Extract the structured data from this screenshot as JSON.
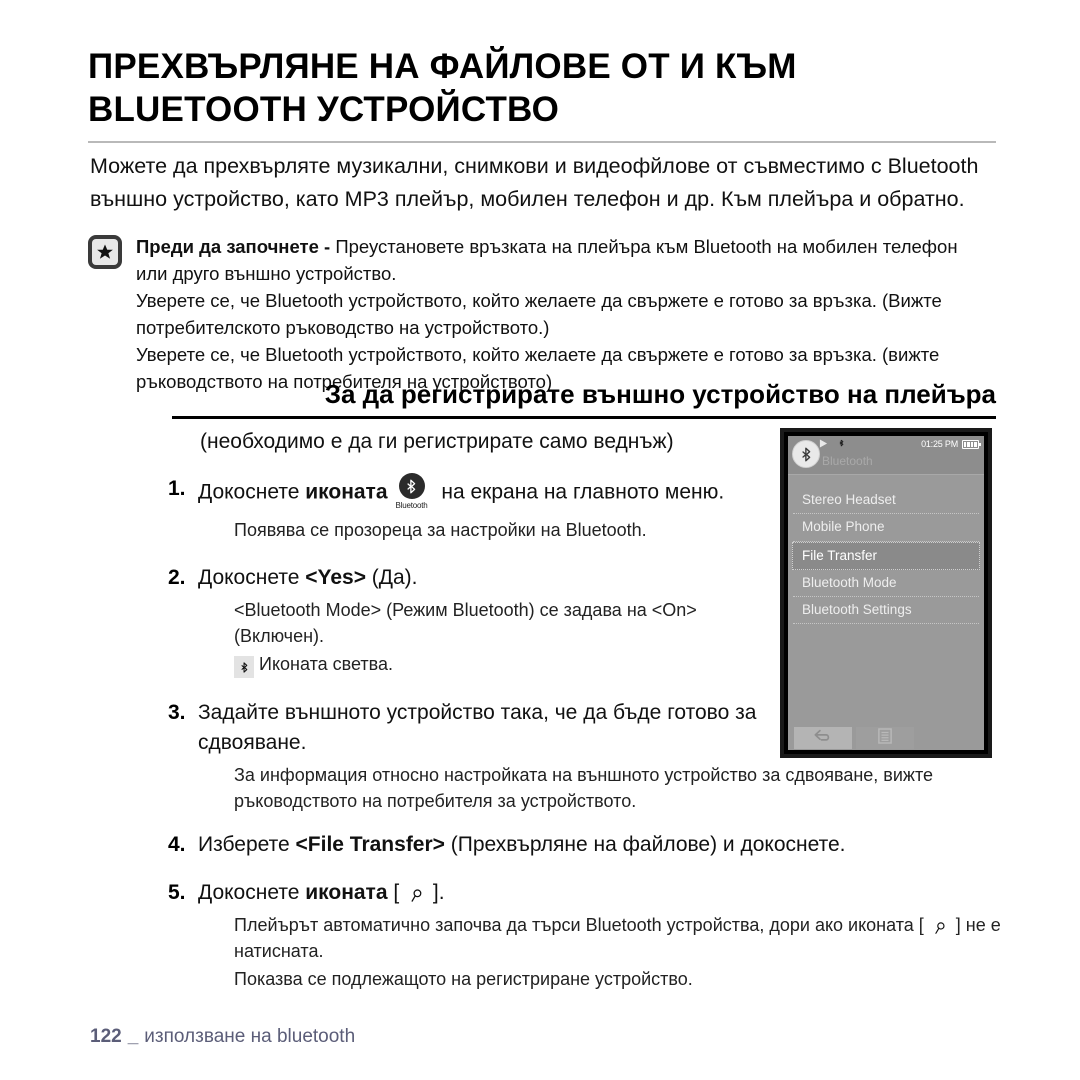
{
  "page": {
    "title": "ПРЕХВЪРЛЯНЕ НА ФАЙЛОВЕ ОТ И КЪМ BLUETOOTH УСТРОЙСТВО",
    "intro": "Можете да прехвърляте музикални, снимкови и видеофйлове от съвместимо с Bluetooth външно устройство, като MP3 плейър, мобилен телефон и др. Към плейъра и обратно."
  },
  "note": {
    "icon": "star-icon",
    "lead": "Преди да започнете - ",
    "line1": "Преустановете връзката на плейъра към Bluetooth на мобилен телефон или друго външно устройство.",
    "line2": "Уверете се, че Bluetooth устройството, който желаете да свържете е готово за връзка. (Вижте потребителското ръководство на устройството.)",
    "line3": "Уверете се, че Bluetooth устройството, който желаете да свържете е готово за връзка. (вижте ръководството на потребителя на устройството)"
  },
  "section": {
    "heading": "За да регистрирате външно устройство на плейъра",
    "once_note": "(необходимо е да ги регистрирате само веднъж)"
  },
  "steps": {
    "s1": {
      "num": "1.",
      "pre": "Докоснете ",
      "bold": "иконата",
      "icon": "bluetooth-icon",
      "icon_label": "Bluetooth",
      "post": " на екрана на главното меню.",
      "sub": "Появява се прозореца за настройки на Bluetooth."
    },
    "s2": {
      "num": "2.",
      "pre": "Докоснете ",
      "bold": "<Yes>",
      "post": " (Да).",
      "sub1": "<Bluetooth Mode> (Режим Bluetooth) се задава на <On> (Включен).",
      "sub2_icon": "bluetooth-chip-icon",
      "sub2": "Иконата светва."
    },
    "s3": {
      "num": "3.",
      "text": "Задайте външното устройство така, че да бъде готово за сдвояване.",
      "sub": "За информация относно настройката на външното устройство за сдвояване, вижте ръководството на потребителя за устройството."
    },
    "s4": {
      "num": "4.",
      "pre": "Изберете  ",
      "bold": "<File Transfer>",
      "post": " (Прехвърляне на файлове) и докоснете."
    },
    "s5": {
      "num": "5.",
      "pre": "Докоснете ",
      "bold": "иконата",
      "bracket_open": " [ ",
      "icon": "search-icon",
      "bracket_close": " ].",
      "sub1a": "Плейърът автоматично започва да търси Bluetooth устройства, дори ако иконата [ ",
      "sub1b": " ] не е натисната.",
      "sub2": "Показва се подлежащото на регистриране устройство."
    }
  },
  "device": {
    "statusbar": {
      "play_icon": "play-icon",
      "bt_icon": "bluetooth-status-icon",
      "time": "01:25 PM",
      "battery_icon": "battery-full-icon"
    },
    "screen_title": "Bluetooth",
    "badge_icon": "bluetooth-badge-icon",
    "menu": [
      {
        "label": "Stereo Headset",
        "selected": false
      },
      {
        "label": "Mobile Phone",
        "selected": false
      },
      {
        "label": "File Transfer",
        "selected": true
      },
      {
        "label": "Bluetooth Mode",
        "selected": false
      },
      {
        "label": "Bluetooth Settings",
        "selected": false
      }
    ],
    "toolbar": [
      {
        "icon": "back-arrow-icon",
        "name": "back-button"
      },
      {
        "icon": "list-menu-icon",
        "name": "menu-button"
      }
    ]
  },
  "footer": {
    "page_number": "122",
    "separator": "_",
    "label": "използване на bluetooth",
    "color": "#5b5d78"
  }
}
